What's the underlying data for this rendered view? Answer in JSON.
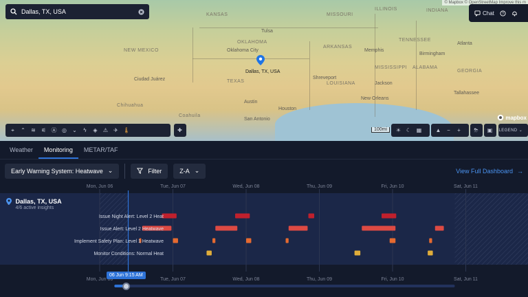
{
  "map": {
    "attribution": "© Mapbox © OpenStreetMap Improve this m",
    "search_value": "Dallas, TX, USA",
    "chat_label": "Chat",
    "pin_label": "Dallas, TX, USA",
    "mapbox_label": "mapbox",
    "scale_label": "100mi",
    "legend_label": "LEGEND",
    "region_labels": [
      "KANSAS",
      "MISSOURI",
      "OKLAHOMA",
      "ARKANSAS",
      "TEXAS",
      "LOUISIANA",
      "MISSISSIPPI",
      "ALABAMA",
      "GEORGIA",
      "TENNESSEE",
      "ILLINOIS",
      "INDIANA",
      "NEW MEXICO",
      "Chihuahua",
      "Coahuila"
    ],
    "city_labels": [
      "Tulsa",
      "Oklahoma City",
      "Memphis",
      "Birmingham",
      "Atlanta",
      "Jackson",
      "Shreveport",
      "Austin",
      "Houston",
      "San Antonio",
      "New Orleans",
      "Ciudad Juárez",
      "Tallahassee"
    ]
  },
  "tabs": [
    "Weather",
    "Monitoring",
    "METAR/TAF"
  ],
  "active_tab": "Monitoring",
  "controls": {
    "system_select": "Early Warning System: Heatwave",
    "filter_label": "Filter",
    "sort_select": "Z-A",
    "dashboard_link": "View Full Dashboard"
  },
  "timeline": {
    "days": [
      "Mon, Jun 06",
      "Tue, Jun 07",
      "Wed, Jun 08",
      "Thu, Jun 09",
      "Fri, Jun 10",
      "Sat, Jun 11"
    ],
    "location": "Dallas, TX, USA",
    "insights": "4/6 active insights",
    "current_time": "06 Jun 9:15 AM",
    "current_time_offset_days": 0.39,
    "rows": [
      {
        "label": "Issue Night Alert: Level 2 Heat",
        "color": "#c0202d",
        "events": [
          [
            0.85,
            1.05
          ],
          [
            1.85,
            2.05
          ],
          [
            2.85,
            2.93
          ],
          [
            3.85,
            4.05
          ]
        ]
      },
      {
        "label": "Issue Alert: Level 2 Heatwave",
        "color": "#dd4a43",
        "events": [
          [
            0.58,
            0.98
          ],
          [
            1.58,
            1.88
          ],
          [
            2.58,
            2.84
          ],
          [
            3.58,
            4.04
          ],
          [
            4.58,
            4.7
          ]
        ]
      },
      {
        "label": "Implement Safety Plan: Level 1 Heatwave",
        "color": "#e56a30",
        "events": [
          [
            0.54,
            0.56
          ],
          [
            1.0,
            1.07
          ],
          [
            1.54,
            1.58
          ],
          [
            2.0,
            2.07
          ],
          [
            2.54,
            2.58
          ],
          [
            3.96,
            4.04
          ],
          [
            4.5,
            4.54
          ]
        ]
      },
      {
        "label": "Monitor Conditions: Normal Heat",
        "color": "#e0ad3a",
        "events": [
          [
            1.46,
            1.53
          ],
          [
            3.48,
            3.56
          ],
          [
            4.48,
            4.55
          ]
        ]
      }
    ]
  }
}
